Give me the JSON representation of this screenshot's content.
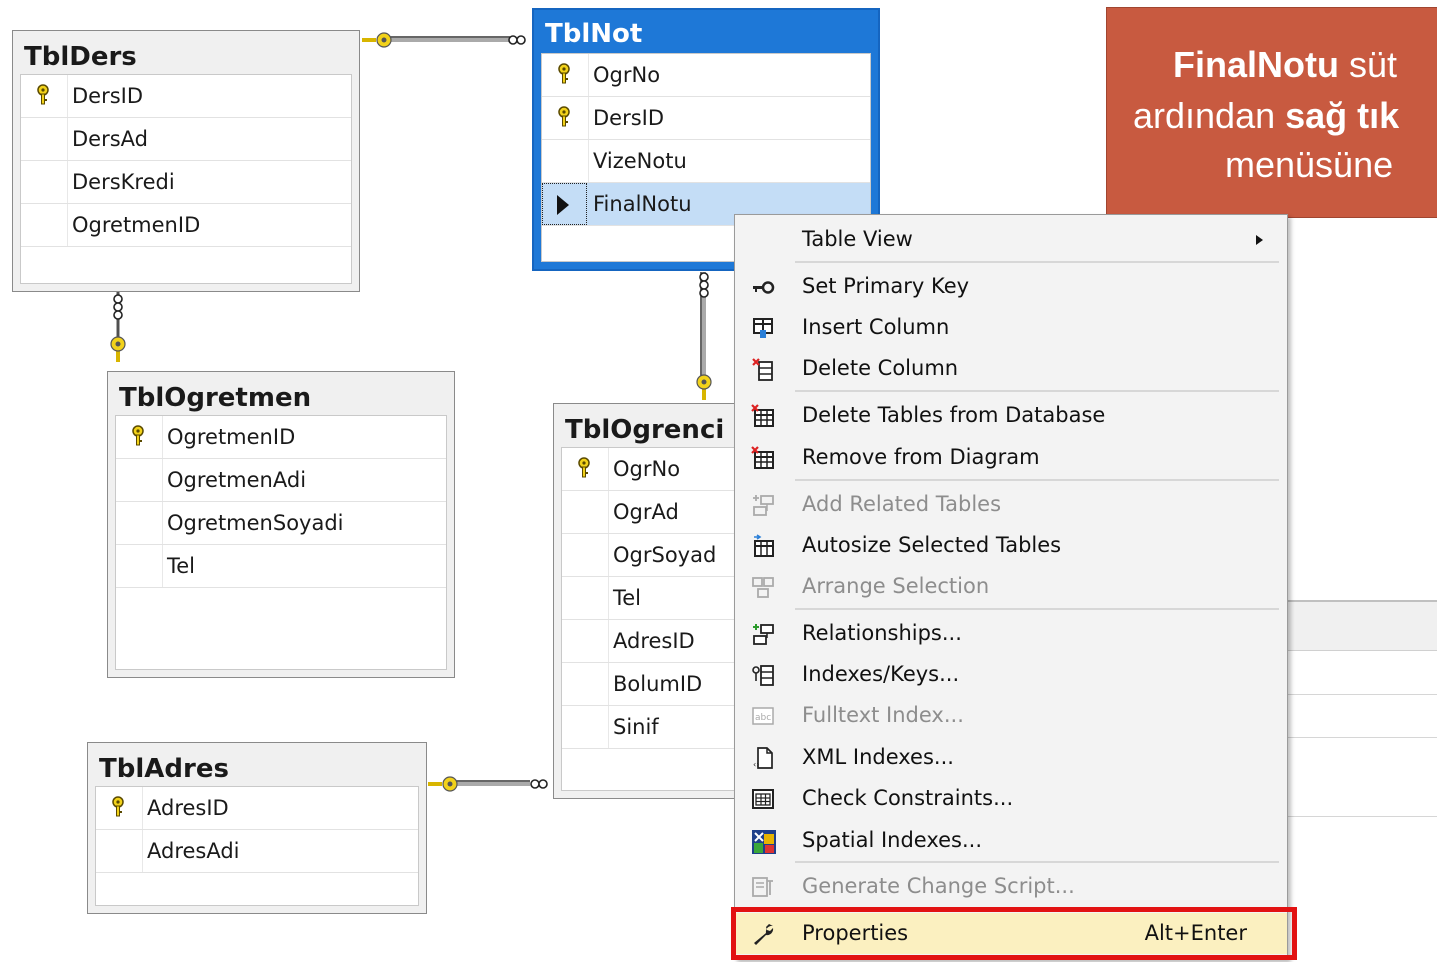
{
  "tables": [
    {
      "name": "TblDers",
      "selected": false,
      "columns": [
        {
          "name": "DersID",
          "key": true
        },
        {
          "name": "DersAd",
          "key": false
        },
        {
          "name": "DersKredi",
          "key": false
        },
        {
          "name": "OgretmenID",
          "key": false
        }
      ]
    },
    {
      "name": "TblNot",
      "selected": true,
      "columns": [
        {
          "name": "OgrNo",
          "key": true
        },
        {
          "name": "DersID",
          "key": true
        },
        {
          "name": "VizeNotu",
          "key": false
        },
        {
          "name": "FinalNotu",
          "key": false,
          "active": true
        }
      ]
    },
    {
      "name": "TblOgretmen",
      "selected": false,
      "columns": [
        {
          "name": "OgretmenID",
          "key": true
        },
        {
          "name": "OgretmenAdi",
          "key": false
        },
        {
          "name": "OgretmenSoyadi",
          "key": false
        },
        {
          "name": "Tel",
          "key": false
        }
      ]
    },
    {
      "name": "TblOgrenci",
      "selected": false,
      "columns": [
        {
          "name": "OgrNo",
          "key": true
        },
        {
          "name": "OgrAd",
          "key": false
        },
        {
          "name": "OgrSoyad",
          "key": false
        },
        {
          "name": "Tel",
          "key": false
        },
        {
          "name": "AdresID",
          "key": false
        },
        {
          "name": "BolumID",
          "key": false
        },
        {
          "name": "Sinif",
          "key": false
        }
      ]
    },
    {
      "name": "TblAdres",
      "selected": false,
      "columns": [
        {
          "name": "AdresID",
          "key": true
        },
        {
          "name": "AdresAdi",
          "key": false
        }
      ]
    }
  ],
  "context_menu": {
    "items": [
      {
        "label": "Table View",
        "icon": "none",
        "disabled": false,
        "submenu": true
      },
      {
        "label": "Set Primary Key",
        "icon": "key-icon",
        "disabled": false
      },
      {
        "label": "Insert Column",
        "icon": "insert-column-icon",
        "disabled": false
      },
      {
        "label": "Delete Column",
        "icon": "delete-column-icon",
        "disabled": false
      },
      {
        "label": "Delete Tables from Database",
        "icon": "delete-table-icon",
        "disabled": false
      },
      {
        "label": "Remove from Diagram",
        "icon": "remove-table-icon",
        "disabled": false
      },
      {
        "label": "Add Related Tables",
        "icon": "add-related-icon",
        "disabled": true
      },
      {
        "label": "Autosize Selected Tables",
        "icon": "autosize-icon",
        "disabled": false
      },
      {
        "label": "Arrange Selection",
        "icon": "arrange-icon",
        "disabled": true
      },
      {
        "label": "Relationships...",
        "icon": "relationships-icon",
        "disabled": false
      },
      {
        "label": "Indexes/Keys...",
        "icon": "indexes-icon",
        "disabled": false
      },
      {
        "label": "Fulltext Index...",
        "icon": "fulltext-icon",
        "disabled": true
      },
      {
        "label": "XML Indexes...",
        "icon": "xml-icon",
        "disabled": false
      },
      {
        "label": "Check Constraints...",
        "icon": "check-constraints-icon",
        "disabled": false
      },
      {
        "label": "Spatial Indexes...",
        "icon": "spatial-icon",
        "disabled": false
      },
      {
        "label": "Generate Change Script...",
        "icon": "script-icon",
        "disabled": true
      },
      {
        "label": "Properties",
        "icon": "wrench-icon",
        "disabled": false,
        "shortcut": "Alt+Enter",
        "highlighted": true
      }
    ]
  },
  "callout": {
    "line1_bold": "FinalNotu",
    "line1_rest": " süt",
    "line2_pre": "ardından ",
    "line2_bold": "sağ tık",
    "line3": "menüsüne"
  },
  "colors": {
    "selected_table": "#1e78d7",
    "callout": "#c85a40",
    "highlight_border": "#e21212",
    "key": "#f2d21a"
  }
}
